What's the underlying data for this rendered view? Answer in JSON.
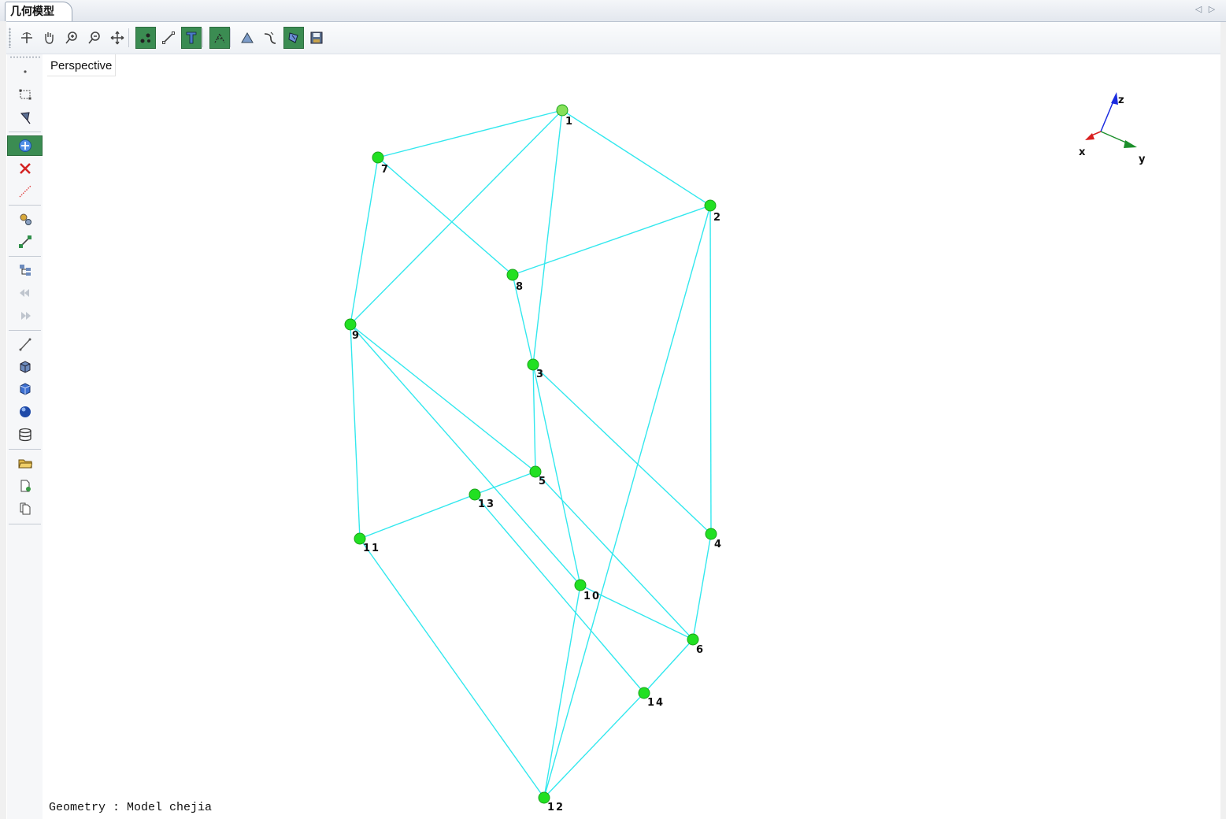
{
  "tab": {
    "title": "几何模型"
  },
  "view": {
    "label": "Perspective"
  },
  "status": {
    "text": "Geometry : Model chejia"
  },
  "colors": {
    "edge": "#33e8ee",
    "node": "#22e022",
    "node_highlight": "#86e05a",
    "active_button": "#3b8c52"
  },
  "toolbar": [
    {
      "icon": "rotate-icon",
      "active": false
    },
    {
      "icon": "pan-hand-icon",
      "active": false
    },
    {
      "icon": "zoom-in-icon",
      "active": false
    },
    {
      "icon": "zoom-out-icon",
      "active": false
    },
    {
      "icon": "move-arrows-icon",
      "active": false
    },
    {
      "icon": "show-points-icon",
      "active": true
    },
    {
      "icon": "show-lines-icon",
      "active": false
    },
    {
      "icon": "show-surfaces-icon",
      "active": true
    },
    {
      "icon": "show-mesh-icon",
      "active": true
    },
    {
      "icon": "triangle-icon",
      "active": false
    },
    {
      "icon": "curve-icon",
      "active": false
    },
    {
      "icon": "render-icon",
      "active": true
    },
    {
      "icon": "save-icon",
      "active": false
    }
  ],
  "sidebar": [
    {
      "icon": "point-icon",
      "active": false
    },
    {
      "icon": "select-box-icon",
      "active": false
    },
    {
      "icon": "pick-icon",
      "active": false
    },
    {
      "icon": "add-point-icon",
      "active": true
    },
    {
      "icon": "delete-icon",
      "active": false
    },
    {
      "icon": "dashed-line-icon",
      "active": false
    },
    {
      "icon": "settings-gears-icon",
      "active": false
    },
    {
      "icon": "connect-line-icon",
      "active": false
    },
    {
      "icon": "tree-icon",
      "active": false
    },
    {
      "icon": "step-back-icon",
      "active": false
    },
    {
      "icon": "step-forward-icon",
      "active": false
    },
    {
      "icon": "line-icon",
      "active": false
    },
    {
      "icon": "mesh-icon",
      "active": false
    },
    {
      "icon": "cube-icon",
      "active": false
    },
    {
      "icon": "sphere-icon",
      "active": false
    },
    {
      "icon": "cylinder-icon",
      "active": false
    },
    {
      "icon": "open-folder-icon",
      "active": false
    },
    {
      "icon": "new-document-icon",
      "active": false
    },
    {
      "icon": "copy-document-icon",
      "active": false
    }
  ],
  "axes": {
    "x_label": "x",
    "y_label": "y",
    "z_label": "z"
  },
  "nodes": [
    {
      "id": "1",
      "label": "1"
    },
    {
      "id": "2",
      "label": "2"
    },
    {
      "id": "3",
      "label": "3"
    },
    {
      "id": "4",
      "label": "4"
    },
    {
      "id": "5",
      "label": "5"
    },
    {
      "id": "6",
      "label": "6"
    },
    {
      "id": "7",
      "label": "7"
    },
    {
      "id": "8",
      "label": "8"
    },
    {
      "id": "9",
      "label": "9"
    },
    {
      "id": "10",
      "label": "10"
    },
    {
      "id": "11",
      "label": "11"
    },
    {
      "id": "12",
      "label": "12"
    },
    {
      "id": "13",
      "label": "13"
    },
    {
      "id": "14",
      "label": "14"
    }
  ],
  "edges": [
    [
      "1",
      "7"
    ],
    [
      "1",
      "2"
    ],
    [
      "1",
      "9"
    ],
    [
      "1",
      "3"
    ],
    [
      "7",
      "9"
    ],
    [
      "7",
      "8"
    ],
    [
      "8",
      "2"
    ],
    [
      "8",
      "3"
    ],
    [
      "2",
      "4"
    ],
    [
      "2",
      "12"
    ],
    [
      "9",
      "11"
    ],
    [
      "9",
      "5"
    ],
    [
      "9",
      "10"
    ],
    [
      "3",
      "5"
    ],
    [
      "3",
      "4"
    ],
    [
      "3",
      "10"
    ],
    [
      "5",
      "13"
    ],
    [
      "5",
      "6"
    ],
    [
      "13",
      "11"
    ],
    [
      "13",
      "14"
    ],
    [
      "11",
      "12"
    ],
    [
      "10",
      "6"
    ],
    [
      "10",
      "12"
    ],
    [
      "4",
      "6"
    ],
    [
      "6",
      "14"
    ],
    [
      "14",
      "12"
    ]
  ]
}
